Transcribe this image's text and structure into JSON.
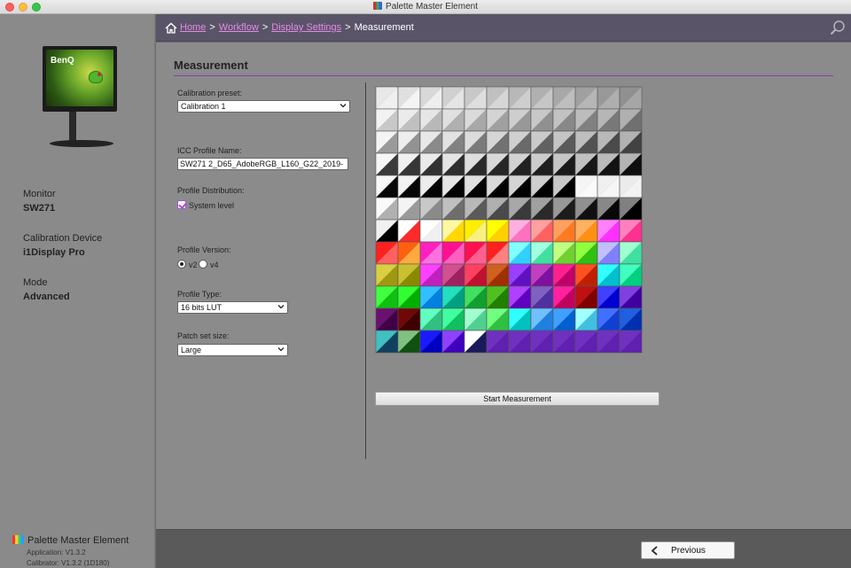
{
  "window": {
    "title": "Palette Master Element"
  },
  "breadcrumb": {
    "home": "Home",
    "workflow": "Workflow",
    "display_settings": "Display Settings",
    "current": "Measurement",
    "separator": ">"
  },
  "sidebar": {
    "monitor_brand": "BenQ",
    "monitor_label": "Monitor",
    "monitor_value": "SW271",
    "device_label": "Calibration Device",
    "device_value": "i1Display Pro",
    "mode_label": "Mode",
    "mode_value": "Advanced",
    "app_name": "Palette Master Element",
    "app_version": "Application: V1.3.2",
    "calibrator_version": "Calibrator: V1.3.2 (1D180)"
  },
  "main": {
    "section_title": "Measurement",
    "calibration_preset_label": "Calibration preset:",
    "calibration_preset_value": "Calibration 1",
    "icc_label": "ICC Profile Name:",
    "icc_value": "SW271 2_D65_AdobeRGB_L160_G22_2019-",
    "distribution_label": "Profile Distribution:",
    "system_level_label": "System level",
    "system_level_checked": true,
    "version_label": "Profile Version:",
    "version_options": [
      "v2",
      "v4"
    ],
    "version_selected": "v2",
    "type_label": "Profile Type:",
    "type_value": "16 bits LUT",
    "patch_label": "Patch set size:",
    "patch_value": "Large",
    "start_button": "Start Measurement"
  },
  "footer": {
    "previous_button": "Previous"
  },
  "patches": {
    "rows": 12,
    "cols": 12,
    "cells": [
      [
        "#e8e8e8",
        "#f0f0f0",
        "#e0e0e0",
        "#f4f4f4",
        "#d8d8d8",
        "#eeeeee",
        "#d0d0d0",
        "#e4e4e4",
        "#c8c8c8",
        "#dedede",
        "#c0c0c0",
        "#d6d6d6",
        "#b8b8b8",
        "#cecece",
        "#b0b0b0",
        "#c6c6c6",
        "#a8a8a8",
        "#bebebe",
        "#a0a0a0",
        "#b6b6b6",
        "#989898",
        "#aeaeae",
        "#909090",
        "#a6a6a6"
      ],
      [
        "#f2f2f2",
        "#c8c8c8",
        "#ebebeb",
        "#c0c0c0",
        "#e6e6e6",
        "#b8b8b8",
        "#e0e0e0",
        "#b0b0b0",
        "#dadada",
        "#a8a8a8",
        "#d4d4d4",
        "#a0a0a0",
        "#cecece",
        "#989898",
        "#c8c8c8",
        "#909090",
        "#c2c2c2",
        "#888888",
        "#bcbcbc",
        "#808080",
        "#b6b6b6",
        "#787878",
        "#b0b0b0",
        "#707070"
      ],
      [
        "#f4f4f4",
        "#9a9a9a",
        "#eeeeee",
        "#929292",
        "#e8e8e8",
        "#8a8a8a",
        "#e2e2e2",
        "#828282",
        "#dcdcdc",
        "#7a7a7a",
        "#d6d6d6",
        "#727272",
        "#d0d0d0",
        "#6a6a6a",
        "#cacaca",
        "#626262",
        "#c4c4c4",
        "#5a5a5a",
        "#bebebe",
        "#525252",
        "#b8b8b8",
        "#4a4a4a",
        "#b2b2b2",
        "#424242"
      ],
      [
        "#f6f6f6",
        "#3a3a3a",
        "#f0f0f0",
        "#363636",
        "#eaeaea",
        "#323232",
        "#e4e4e4",
        "#2e2e2e",
        "#dedede",
        "#2a2a2a",
        "#d8d8d8",
        "#262626",
        "#d2d2d2",
        "#222222",
        "#cccccc",
        "#1e1e1e",
        "#c6c6c6",
        "#1a1a1a",
        "#c0c0c0",
        "#161616",
        "#bababa",
        "#121212",
        "#b4b4b4",
        "#0e0e0e"
      ],
      [
        "#f8f8f8",
        "#080808",
        "#f2f2f2",
        "#060606",
        "#ececec",
        "#050505",
        "#e6e6e6",
        "#040404",
        "#e0e0e0",
        "#030303",
        "#dadada",
        "#020202",
        "#d4d4d4",
        "#010101",
        "#cecece",
        "#000000",
        "#c8c8c8",
        "#000000",
        "#f5f5f5",
        "#fafafa",
        "#f0f0f0",
        "#f6f6f6",
        "#ebebeb",
        "#f2f2f2"
      ],
      [
        "#fafafa",
        "#b0b0b0",
        "#f4f4f4",
        "#9a9a9a",
        "#c8c8c8",
        "#8a8a8a",
        "#c0c0c0",
        "#6e6e6e",
        "#b8b8b8",
        "#5a5a5a",
        "#b0b0b0",
        "#4a4a4a",
        "#a8a8a8",
        "#3a3a3a",
        "#a0a0a0",
        "#2a2a2a",
        "#989898",
        "#1c1c1c",
        "#909090",
        "#101010",
        "#888888",
        "#080808",
        "#808080",
        "#000000"
      ],
      [
        "#f0f0f0",
        "#000000",
        "#ffffff",
        "#ff2a2a",
        "#ffffff",
        "#f0f0f0",
        "#fff8a0",
        "#ffd800",
        "#ffee00",
        "#f8f080",
        "#ffff00",
        "#ffd000",
        "#ffb0e0",
        "#ff70c0",
        "#ffa0a0",
        "#ff6060",
        "#ffa060",
        "#ff7a20",
        "#ffb060",
        "#ff9010",
        "#ff80ff",
        "#ff30ff",
        "#ff80c0",
        "#ff3090"
      ],
      [
        "#ff2020",
        "#ff6060",
        "#ff6010",
        "#ffaa40",
        "#ff20c0",
        "#ff70e0",
        "#ff1090",
        "#ff60c0",
        "#ff1050",
        "#ff6090",
        "#ff2020",
        "#ff8080",
        "#80ffff",
        "#30d0ff",
        "#a0ffe0",
        "#40e0a0",
        "#c0ff80",
        "#70d030",
        "#90ff40",
        "#30c010",
        "#c0c0ff",
        "#8080ff",
        "#a0ffd0",
        "#40e0a0"
      ],
      [
        "#d8d040",
        "#a09810",
        "#c8c030",
        "#8a8a00",
        "#ff40ff",
        "#c020c0",
        "#d05090",
        "#a02060",
        "#ff4060",
        "#c01030",
        "#d06020",
        "#a03000",
        "#9a40ff",
        "#6010c0",
        "#c040c0",
        "#8010a0",
        "#ff2090",
        "#c0006a",
        "#ff5020",
        "#c02000",
        "#30ffff",
        "#00c0d0",
        "#40ffc0",
        "#00d080"
      ],
      [
        "#40ff40",
        "#10c010",
        "#30ff30",
        "#00b000",
        "#30c0ff",
        "#0080e0",
        "#20e0c0",
        "#00a080",
        "#40e060",
        "#10a030",
        "#50c020",
        "#208000",
        "#b040ff",
        "#6000c0",
        "#8060c0",
        "#5030a0",
        "#ff20a0",
        "#c00060",
        "#c01010",
        "#800000",
        "#4040ff",
        "#0000d0",
        "#8040e0",
        "#4000a0"
      ],
      [
        "#6a1070",
        "#400048",
        "#700808",
        "#400000",
        "#60ffc0",
        "#30c080",
        "#40ffa0",
        "#10c060",
        "#a0ffd0",
        "#50d090",
        "#70ff80",
        "#30c040",
        "#30ffff",
        "#00c0c0",
        "#70c0ff",
        "#2080e0",
        "#40a0ff",
        "#0060d0",
        "#a0ffff",
        "#40c0e0",
        "#4070ff",
        "#1040d0",
        "#2060e0",
        "#0030b0"
      ],
      [
        "#40c0c0",
        "#104060",
        "#80c080",
        "#105010",
        "#1a1aff",
        "#0000c0",
        "#9040ff",
        "#4000c0",
        "#ffffff",
        "#1a1a5a",
        "#7030c0",
        "#6020b0",
        "#7030c0",
        "#6020b0",
        "#7030c0",
        "#6020b0",
        "#7030c0",
        "#6020b0",
        "#7030c0",
        "#6020b0",
        "#7030c0",
        "#6020b0",
        "#7030c0",
        "#6020b0"
      ]
    ]
  }
}
